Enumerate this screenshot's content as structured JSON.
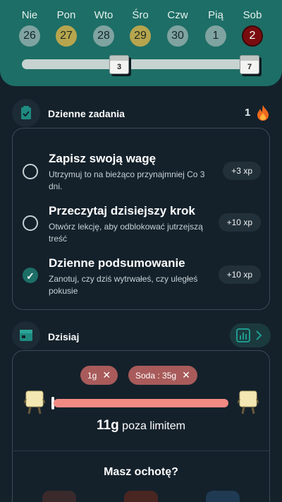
{
  "week": {
    "days": [
      {
        "name": "Nie",
        "number": "26",
        "state": "normal"
      },
      {
        "name": "Pon",
        "number": "27",
        "state": "gold"
      },
      {
        "name": "Wto",
        "number": "28",
        "state": "normal"
      },
      {
        "name": "Śro",
        "number": "29",
        "state": "gold"
      },
      {
        "name": "Czw",
        "number": "30",
        "state": "normal"
      },
      {
        "name": "Pią",
        "number": "1",
        "state": "normal"
      },
      {
        "name": "Sob",
        "number": "2",
        "state": "red"
      }
    ],
    "milestones": [
      "3",
      "7"
    ]
  },
  "daily_tasks": {
    "title": "Dzienne zadania",
    "streak_count": "1",
    "items": [
      {
        "title": "Zapisz swoją wagę",
        "desc": "Utrzymuj to na bieżąco przynajmniej Co 3 dni.",
        "xp": "+3 xp",
        "done": false
      },
      {
        "title": "Przeczytaj dzisiejszy krok",
        "desc": "Otwórz lekcję, aby odblokować jutrzejszą treść",
        "xp": "+10 xp",
        "done": false
      },
      {
        "title": "Dzienne podsumowanie",
        "desc": "Zanotuj, czy dziś wytrwałeś, czy uległeś pokusie",
        "xp": "+10 xp",
        "done": true
      }
    ]
  },
  "today": {
    "title": "Dzisiaj",
    "chips": [
      "1g",
      "Soda : 35g"
    ],
    "limit_value": "11g",
    "limit_suffix": "poza limitem",
    "question": "Masz ochotę?"
  },
  "colors": {
    "header_teal": "#1d6e66",
    "background": "#14212b",
    "chip_red": "#a85b5a",
    "limit_bar": "#f28a84"
  },
  "icons": {
    "tasks": "clipboard-check-icon",
    "today": "calendar-icon",
    "stats": "bar-chart-icon",
    "streak": "flame-icon"
  }
}
